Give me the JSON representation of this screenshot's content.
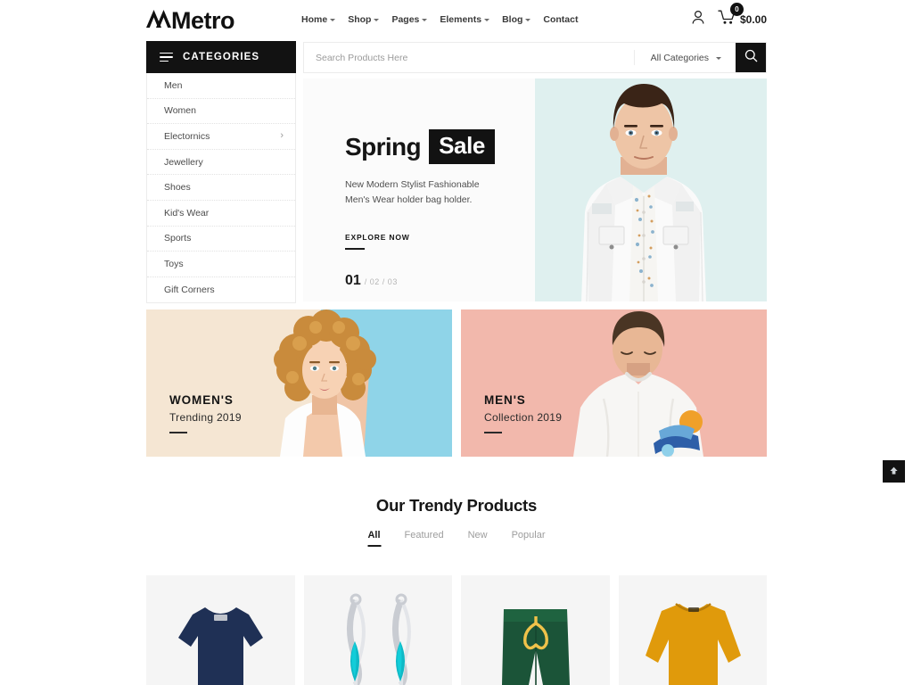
{
  "header": {
    "logo_text": "Metro",
    "logo_icon": "mountain-m-logo",
    "nav": [
      {
        "label": "Home",
        "has_dropdown": true
      },
      {
        "label": "Shop",
        "has_dropdown": true
      },
      {
        "label": "Pages",
        "has_dropdown": true
      },
      {
        "label": "Elements",
        "has_dropdown": true
      },
      {
        "label": "Blog",
        "has_dropdown": true
      },
      {
        "label": "Contact",
        "has_dropdown": false
      }
    ],
    "account_icon": "user-icon",
    "cart_icon": "cart-icon",
    "cart_count": "0",
    "cart_total": "$0.00"
  },
  "sidebar": {
    "heading": "CATEGORIES",
    "menu_icon": "hamburger-icon",
    "items": [
      {
        "label": "Men",
        "has_submenu": false
      },
      {
        "label": "Women",
        "has_submenu": false
      },
      {
        "label": "Electornics",
        "has_submenu": true
      },
      {
        "label": "Jewellery",
        "has_submenu": false
      },
      {
        "label": "Shoes",
        "has_submenu": false
      },
      {
        "label": "Kid's Wear",
        "has_submenu": false
      },
      {
        "label": "Sports",
        "has_submenu": false
      },
      {
        "label": "Toys",
        "has_submenu": false
      },
      {
        "label": "Gift Corners",
        "has_submenu": false
      }
    ],
    "submenu_icon": "chevron-right-icon"
  },
  "search": {
    "placeholder": "Search Products Here",
    "value": "",
    "category_selected": "All Categories",
    "dropdown_icon": "caret-down-icon",
    "button_icon": "search-icon"
  },
  "hero": {
    "title_plain": "Spring",
    "title_highlight": "Sale",
    "description": "New Modern Stylist Fashionable Men's Wear holder bag holder.",
    "cta_label": "EXPLORE NOW",
    "pager_active": "01",
    "pager_rest": "/ 02  / 03",
    "image_alt": "male-model-white-denim-jacket",
    "bg_color": "#dff0ef"
  },
  "promos": [
    {
      "title": "WOMEN'S",
      "subtitle": "Trending 2019",
      "bg_color": "#f5e6d3",
      "accent_color": "#8fd4e8",
      "image_alt": "woman-curly-hair-white-top"
    },
    {
      "title": "MEN'S",
      "subtitle": "Collection 2019",
      "bg_color": "#f2b8ac",
      "accent_color": "#e8a294",
      "image_alt": "man-white-sweatshirt-pink-background"
    }
  ],
  "trendy": {
    "heading": "Our Trendy Products",
    "tabs": [
      {
        "label": "All",
        "active": true
      },
      {
        "label": "Featured",
        "active": false
      },
      {
        "label": "New",
        "active": false
      },
      {
        "label": "Popular",
        "active": false
      }
    ],
    "products": [
      {
        "image_alt": "navy-blue-t-shirt",
        "color": "#1f3055"
      },
      {
        "image_alt": "teal-gemstone-earrings",
        "color": "#11b3bd"
      },
      {
        "image_alt": "green-drawstring-shorts",
        "color": "#1b5438"
      },
      {
        "image_alt": "mustard-yellow-sweater",
        "color": "#e09a0b"
      }
    ]
  },
  "back_to_top": {
    "icon": "arrow-up-icon",
    "label": ""
  }
}
